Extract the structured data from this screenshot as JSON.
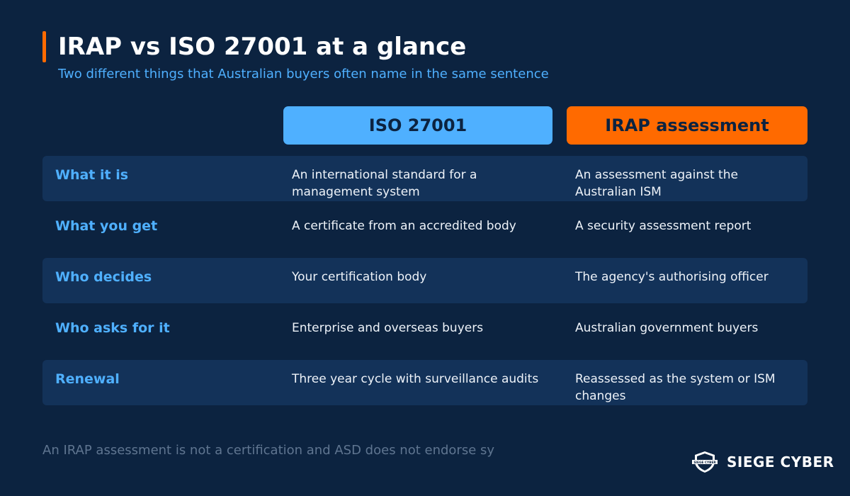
{
  "header": {
    "title": "IRAP vs ISO 27001 at a glance",
    "subtitle": "Two different things that Australian buyers often name in the same sentence"
  },
  "columns": {
    "iso": "ISO 27001",
    "irap": "IRAP assessment"
  },
  "rows": [
    {
      "label": "What it is",
      "iso": "An international standard for a management system",
      "irap": "An assessment against the Australian ISM"
    },
    {
      "label": "What you get",
      "iso": "A certificate from an accredited body",
      "irap": "A security assessment report"
    },
    {
      "label": "Who decides",
      "iso": "Your certification body",
      "irap": "The agency's authorising officer"
    },
    {
      "label": "Who asks for it",
      "iso": "Enterprise and overseas buyers",
      "irap": "Australian government buyers"
    },
    {
      "label": "Renewal",
      "iso": "Three year cycle with surveillance audits",
      "irap": "Reassessed as the system or ISM changes"
    }
  ],
  "footnote": "An IRAP assessment is not a certification and ASD does not endorse sy",
  "brand": {
    "name": "SIEGE CYBER",
    "logo_text": "SIEGE CYBER",
    "icon": "shield-icon"
  },
  "colors": {
    "background": "#0c2340",
    "accent_orange": "#ff6a00",
    "accent_blue": "#4fb0ff",
    "row_shade": "#133259"
  }
}
